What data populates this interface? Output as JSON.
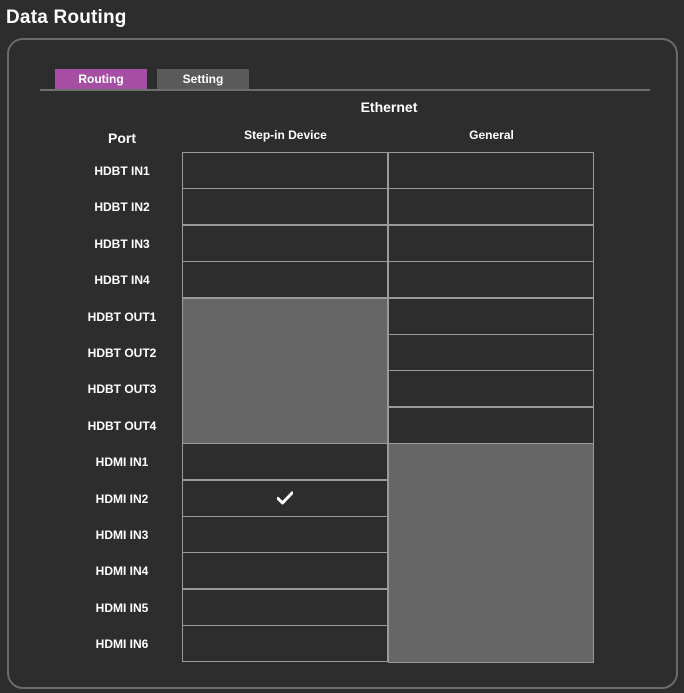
{
  "page": {
    "title": "Data Routing"
  },
  "tabs": [
    {
      "label": "Routing",
      "active": true
    },
    {
      "label": "Setting",
      "active": false
    }
  ],
  "table": {
    "group_header": "Ethernet",
    "port_header": "Port",
    "columns": [
      "Step-in Device",
      "General"
    ],
    "rows": [
      {
        "port": "HDBT IN1",
        "step_in": "empty",
        "general": "empty"
      },
      {
        "port": "HDBT IN2",
        "step_in": "empty",
        "general": "empty"
      },
      {
        "port": "HDBT IN3",
        "step_in": "empty",
        "general": "empty"
      },
      {
        "port": "HDBT IN4",
        "step_in": "empty",
        "general": "empty"
      },
      {
        "port": "HDBT OUT1",
        "step_in": "disabled",
        "general": "empty"
      },
      {
        "port": "HDBT OUT2",
        "step_in": "disabled",
        "general": "empty"
      },
      {
        "port": "HDBT OUT3",
        "step_in": "disabled",
        "general": "empty"
      },
      {
        "port": "HDBT OUT4",
        "step_in": "disabled",
        "general": "empty"
      },
      {
        "port": "HDMI IN1",
        "step_in": "empty",
        "general": "disabled"
      },
      {
        "port": "HDMI IN2",
        "step_in": "checked",
        "general": "disabled"
      },
      {
        "port": "HDMI IN3",
        "step_in": "empty",
        "general": "disabled"
      },
      {
        "port": "HDMI IN4",
        "step_in": "empty",
        "general": "disabled"
      },
      {
        "port": "HDMI IN5",
        "step_in": "empty",
        "general": "disabled"
      },
      {
        "port": "HDMI IN6",
        "step_in": "empty",
        "general": "disabled"
      }
    ]
  },
  "colors": {
    "background": "#2d2d2d",
    "active_tab": "#a64ea4",
    "inactive_tab": "#5a5a5a",
    "disabled_cell": "#666666",
    "grid_line": "#9a9a9a"
  }
}
